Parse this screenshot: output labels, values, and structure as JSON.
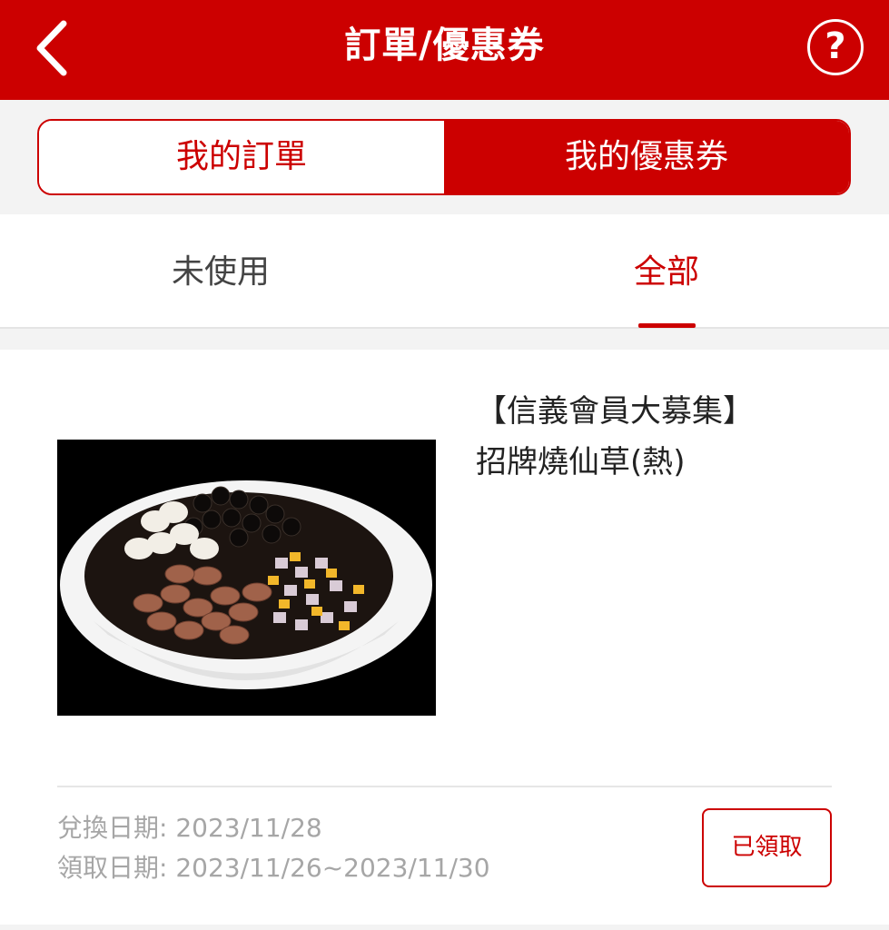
{
  "header": {
    "title": "訂單/優惠券",
    "back_icon": "chevron-left-icon",
    "help_icon": "question-circle-icon",
    "help_glyph": "?",
    "brand_color": "#cc0000"
  },
  "segment": {
    "orders_label": "我的訂單",
    "coupons_label": "我的優惠券",
    "selected": "coupons"
  },
  "filter_tabs": {
    "unused_label": "未使用",
    "all_label": "全部",
    "selected": "all"
  },
  "coupon": {
    "title_line1": "【信義會員大募集】",
    "title_line2": "招牌燒仙草(熱)",
    "redeem_date": "兌換日期: 2023/11/28",
    "claim_period": "領取日期: 2023/11/26~2023/11/30",
    "status_label": "已領取"
  }
}
